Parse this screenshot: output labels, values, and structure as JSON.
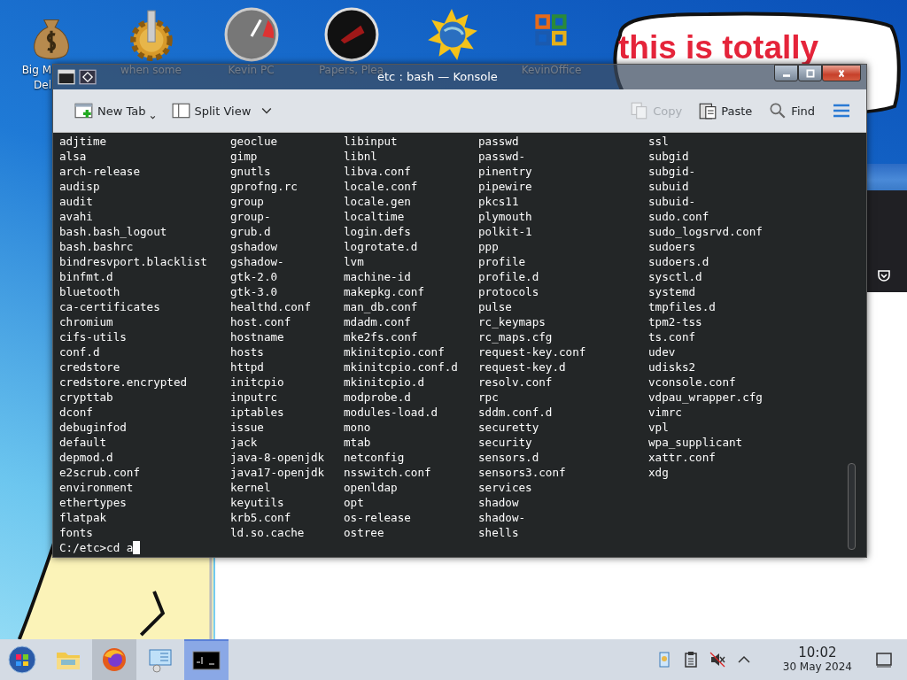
{
  "desktop_icons": [
    {
      "kind": "money-bag",
      "lines": [
        "Big M",
        "Del"
      ]
    },
    {
      "kind": "gear",
      "lines": [
        "when some"
      ]
    },
    {
      "kind": "gauge",
      "lines": [
        "Kevin PC"
      ]
    },
    {
      "kind": "disc",
      "lines": [
        "Papers, Plea"
      ]
    },
    {
      "kind": "globe"
    },
    {
      "kind": "office",
      "lines": [
        "KevinOffice"
      ]
    }
  ],
  "note_bubble": {
    "lines": [
      "this is totally"
    ]
  },
  "window": {
    "title": "etc : bash — Konsole"
  },
  "toolbar": [
    {
      "kind": "new-tab",
      "label": "New Tab",
      "disabled": false
    },
    {
      "kind": "split-view",
      "label": "Split View",
      "disabled": false
    },
    {
      "kind": "copy",
      "label": "Copy",
      "disabled": true
    },
    {
      "kind": "paste",
      "label": "Paste",
      "disabled": false
    },
    {
      "kind": "find",
      "label": "Find",
      "disabled": false
    }
  ],
  "terminal": {
    "columns": [
      [
        "adjtime",
        "alsa",
        "arch-release",
        "audisp",
        "audit",
        "avahi",
        "bash.bash_logout",
        "bash.bashrc",
        "bindresvport.blacklist",
        "binfmt.d",
        "bluetooth",
        "ca-certificates",
        "chromium",
        "cifs-utils",
        "conf.d",
        "credstore",
        "credstore.encrypted",
        "crypttab",
        "dconf",
        "debuginfod",
        "default",
        "depmod.d",
        "e2scrub.conf",
        "environment",
        "ethertypes",
        "flatpak",
        "fonts"
      ],
      [
        "geoclue",
        "gimp",
        "gnutls",
        "gprofng.rc",
        "group",
        "group-",
        "grub.d",
        "gshadow",
        "gshadow-",
        "gtk-2.0",
        "gtk-3.0",
        "healthd.conf",
        "host.conf",
        "hostname",
        "hosts",
        "httpd",
        "initcpio",
        "inputrc",
        "iptables",
        "issue",
        "jack",
        "java-8-openjdk",
        "java17-openjdk",
        "kernel",
        "keyutils",
        "krb5.conf",
        "ld.so.cache"
      ],
      [
        "libinput",
        "libnl",
        "libva.conf",
        "locale.conf",
        "locale.gen",
        "localtime",
        "login.defs",
        "logrotate.d",
        "lvm",
        "machine-id",
        "makepkg.conf",
        "man_db.conf",
        "mdadm.conf",
        "mke2fs.conf",
        "mkinitcpio.conf",
        "mkinitcpio.conf.d",
        "mkinitcpio.d",
        "modprobe.d",
        "modules-load.d",
        "mono",
        "mtab",
        "netconfig",
        "nsswitch.conf",
        "openldap",
        "opt",
        "os-release",
        "ostree"
      ],
      [
        "passwd",
        "passwd-",
        "pinentry",
        "pipewire",
        "pkcs11",
        "plymouth",
        "polkit-1",
        "ppp",
        "profile",
        "profile.d",
        "protocols",
        "pulse",
        "rc_keymaps",
        "rc_maps.cfg",
        "request-key.conf",
        "request-key.d",
        "resolv.conf",
        "rpc",
        "sddm.conf.d",
        "securetty",
        "security",
        "sensors.d",
        "sensors3.conf",
        "services",
        "shadow",
        "shadow-",
        "shells"
      ],
      [
        "ssl",
        "subgid",
        "subgid-",
        "subuid",
        "subuid-",
        "sudo.conf",
        "sudo_logsrvd.conf",
        "sudoers",
        "sudoers.d",
        "sysctl.d",
        "systemd",
        "tmpfiles.d",
        "tpm2-tss",
        "ts.conf",
        "udev",
        "udisks2",
        "vconsole.conf",
        "vdpau_wrapper.cfg",
        "vimrc",
        "vpl",
        "wpa_supplicant",
        "xattr.conf",
        "xdg"
      ]
    ],
    "prompt": "C:/etc>cd a"
  },
  "taskbar": {
    "apps": [
      {
        "kind": "start",
        "selected": false,
        "hovered": false
      },
      {
        "kind": "folder",
        "selected": false,
        "hovered": false
      },
      {
        "kind": "firefox",
        "selected": false,
        "hovered": true
      },
      {
        "kind": "monitor",
        "selected": false,
        "hovered": false
      },
      {
        "kind": "terminal",
        "selected": true,
        "hovered": false
      }
    ],
    "tray": [
      {
        "kind": "user-doc"
      },
      {
        "kind": "clipboard"
      },
      {
        "kind": "speaker-muted"
      },
      {
        "kind": "caret-up"
      }
    ],
    "clock": {
      "time": "10:02",
      "date": "30 May 2024"
    }
  }
}
